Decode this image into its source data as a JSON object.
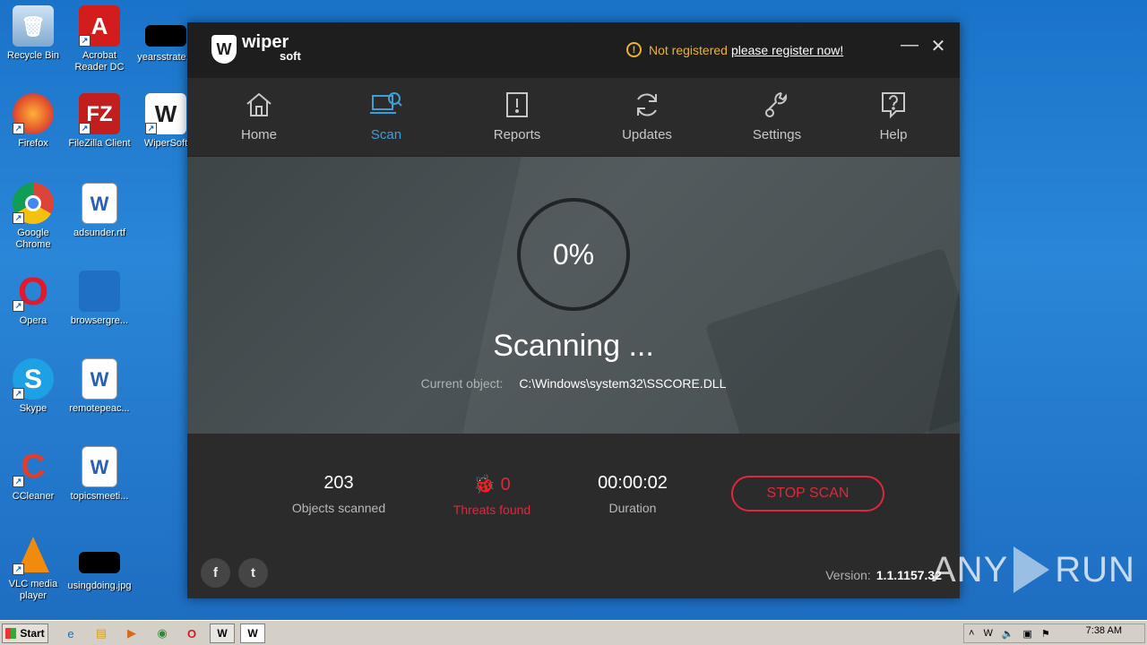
{
  "desktop": {
    "icons": [
      {
        "label": "Recycle Bin"
      },
      {
        "label": "Acrobat Reader DC"
      },
      {
        "label": "yearsstrate..."
      },
      {
        "label": "Firefox"
      },
      {
        "label": "FileZilla Client"
      },
      {
        "label": "WiperSoft"
      },
      {
        "label": "Google Chrome"
      },
      {
        "label": "adsunder.rtf"
      },
      {
        "label": "Opera"
      },
      {
        "label": "browsergre..."
      },
      {
        "label": "Skype"
      },
      {
        "label": "remotepeac..."
      },
      {
        "label": "CCleaner"
      },
      {
        "label": "topicsmeeti..."
      },
      {
        "label": "VLC media player"
      },
      {
        "label": "usingdoing.jpg"
      }
    ]
  },
  "app": {
    "logo_word": "wiper",
    "logo_sub": "soft",
    "registration": {
      "status": "Not registered",
      "link": "please register now!"
    },
    "nav": [
      {
        "label": "Home",
        "icon": "home-icon"
      },
      {
        "label": "Scan",
        "icon": "scan-icon"
      },
      {
        "label": "Reports",
        "icon": "reports-icon"
      },
      {
        "label": "Updates",
        "icon": "updates-icon"
      },
      {
        "label": "Settings",
        "icon": "settings-icon"
      },
      {
        "label": "Help",
        "icon": "help-icon"
      }
    ],
    "scan": {
      "progress": "0%",
      "title": "Scanning ...",
      "current_label": "Current object:",
      "current_value": "C:\\Windows\\system32\\SSCORE.DLL"
    },
    "stats": {
      "objects_value": "203",
      "objects_label": "Objects scanned",
      "threats_value": "0",
      "threats_label": "Threats found",
      "duration_value": "00:00:02",
      "duration_label": "Duration",
      "stop_label": "STOP SCAN"
    },
    "footer": {
      "version_label": "Version:",
      "version_value": "1.1.1157.32"
    },
    "colors": {
      "accent": "#3aa0d8",
      "danger": "#e0273c",
      "warning": "#e9b42c"
    }
  },
  "watermark": {
    "left": "ANY",
    "right": "RUN"
  },
  "taskbar": {
    "start": "Start",
    "clock": "7:38 AM"
  }
}
